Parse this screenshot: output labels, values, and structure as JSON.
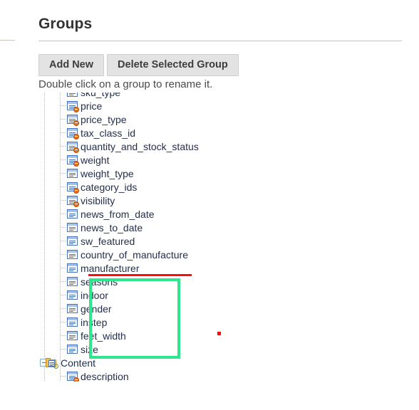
{
  "page": {
    "title": "Groups",
    "hint": "Double click on a group to rename it."
  },
  "toolbar": {
    "add_new_label": "Add New",
    "delete_label": "Delete Selected Group"
  },
  "tree": {
    "nodes": [
      {
        "label": "sku_type",
        "type": "attribute",
        "required": false,
        "clipped": "top"
      },
      {
        "label": "price",
        "type": "attribute",
        "required": true
      },
      {
        "label": "price_type",
        "type": "attribute",
        "required": true
      },
      {
        "label": "tax_class_id",
        "type": "attribute",
        "required": true
      },
      {
        "label": "quantity_and_stock_status",
        "type": "attribute",
        "required": true
      },
      {
        "label": "weight",
        "type": "attribute",
        "required": true
      },
      {
        "label": "weight_type",
        "type": "attribute",
        "required": false
      },
      {
        "label": "category_ids",
        "type": "attribute",
        "required": true
      },
      {
        "label": "visibility",
        "type": "attribute",
        "required": true
      },
      {
        "label": "news_from_date",
        "type": "attribute",
        "required": false
      },
      {
        "label": "news_to_date",
        "type": "attribute",
        "required": false
      },
      {
        "label": "sw_featured",
        "type": "attribute",
        "required": false
      },
      {
        "label": "country_of_manufacture",
        "type": "attribute",
        "required": false
      },
      {
        "label": "manufacturer",
        "type": "attribute",
        "required": false
      },
      {
        "label": "seasons",
        "type": "attribute",
        "required": false
      },
      {
        "label": "indoor",
        "type": "attribute",
        "required": false
      },
      {
        "label": "gender",
        "type": "attribute",
        "required": false
      },
      {
        "label": "instep",
        "type": "attribute",
        "required": false
      },
      {
        "label": "feet_width",
        "type": "attribute",
        "required": false
      },
      {
        "label": "size",
        "type": "attribute",
        "required": false
      },
      {
        "label": "Content",
        "type": "folder",
        "expanded": true,
        "toggle": "collapse-icon"
      },
      {
        "label": "description",
        "type": "attribute",
        "required": true,
        "clipped": "bottom"
      }
    ]
  },
  "annotations": {
    "red_underline": {
      "under_label": "manufacturer",
      "color": "#fb0d0d"
    },
    "green_box": {
      "encloses": [
        "seasons",
        "indoor",
        "gender",
        "instep",
        "feet_width",
        "size"
      ],
      "color": "#2ee68c"
    },
    "red_dot": {
      "color": "#fb0d0d"
    }
  },
  "scrollbar": {
    "orientation": "vertical",
    "position_percent": 9
  }
}
